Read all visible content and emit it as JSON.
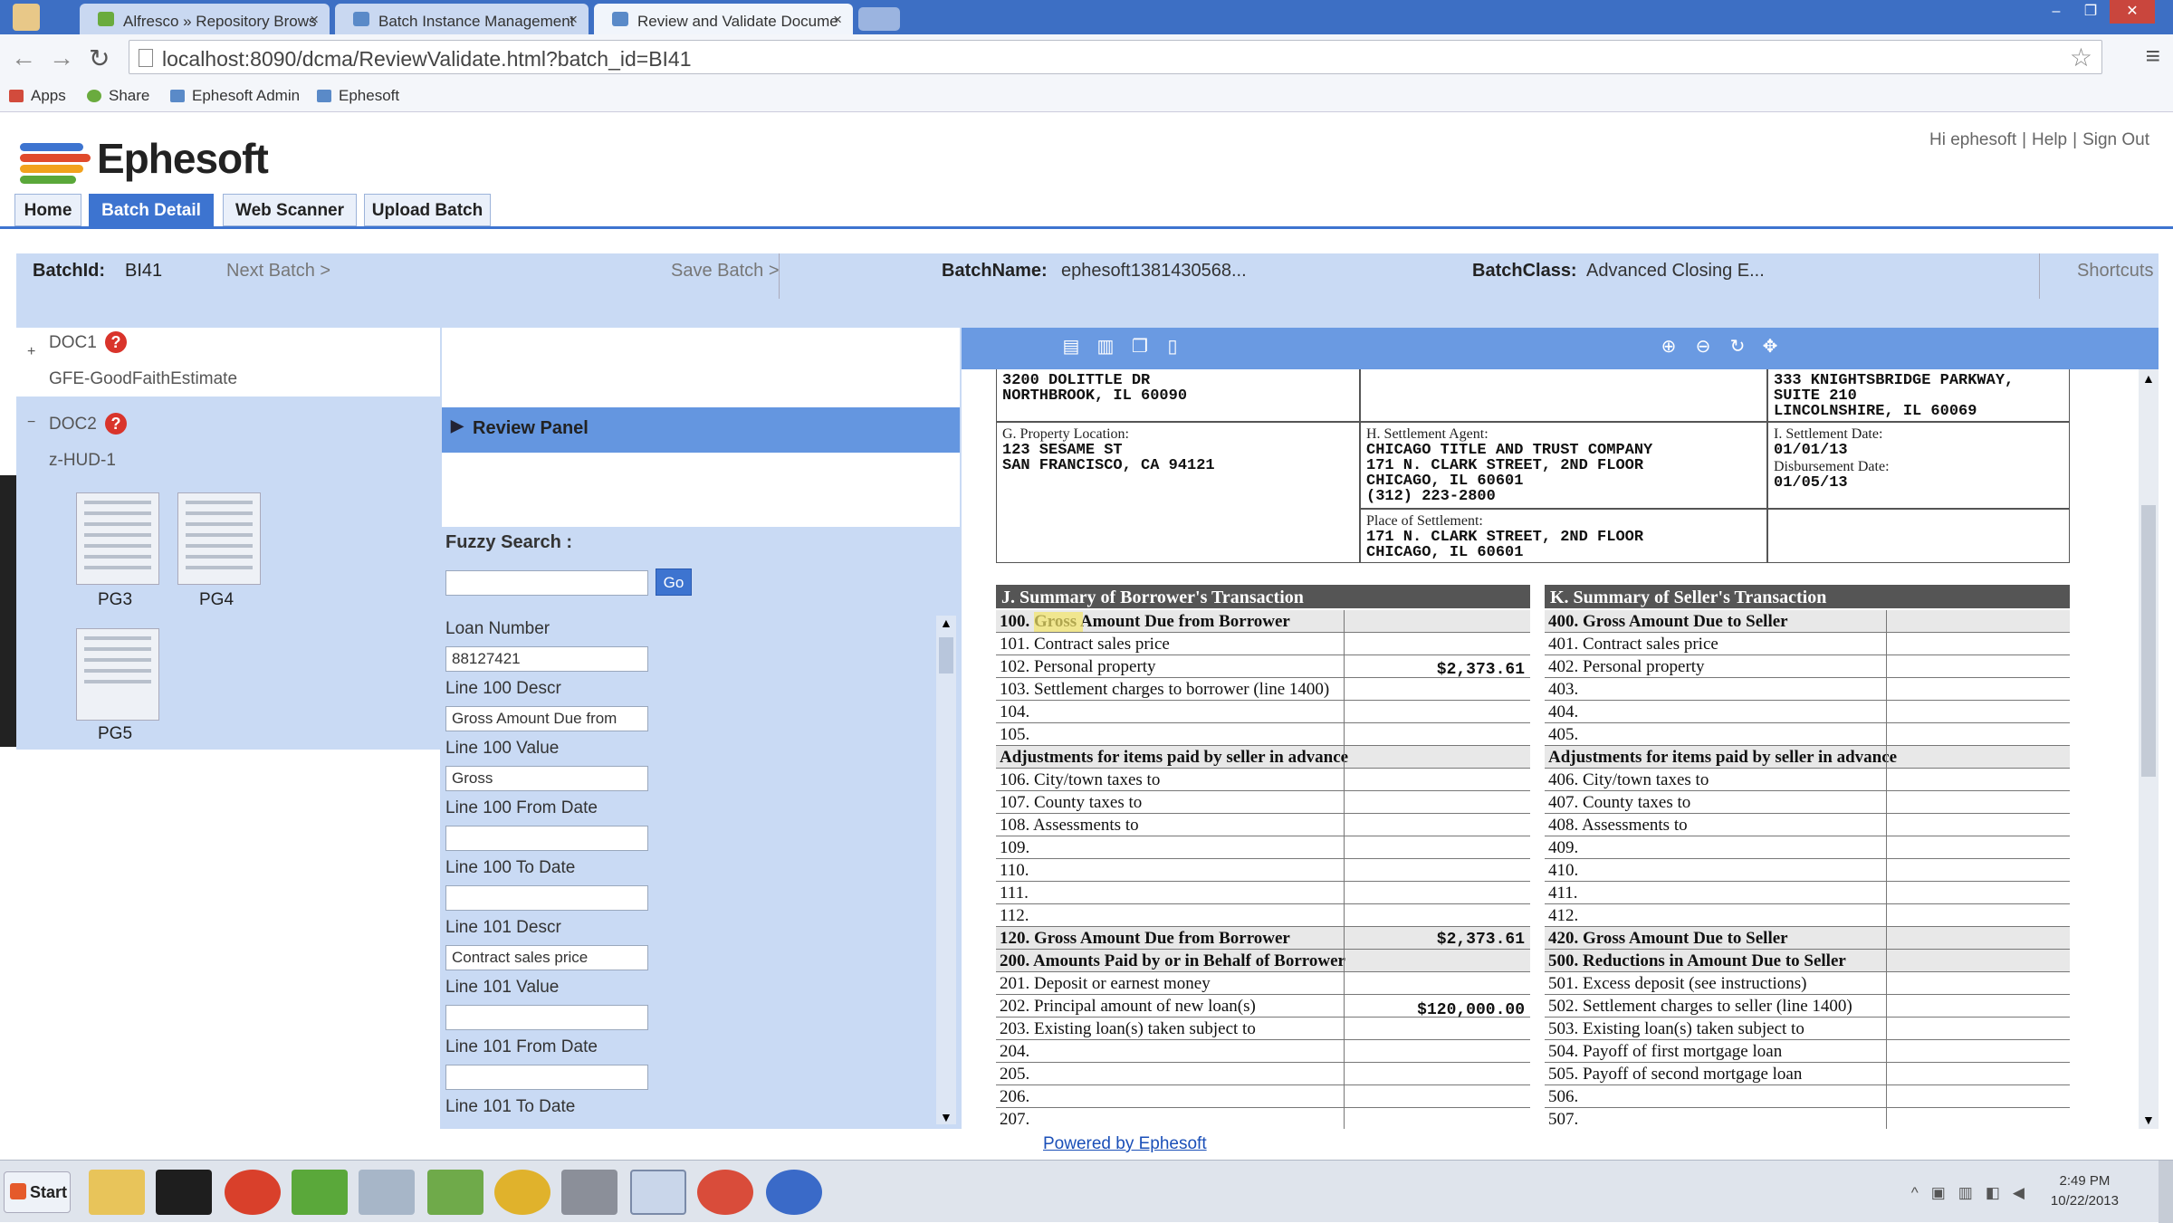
{
  "browser": {
    "tabs": [
      {
        "label": "Alfresco » Repository Brows",
        "icon_color": "#6aab3e"
      },
      {
        "label": "Batch Instance Management",
        "icon_color": "#5a8ac8"
      },
      {
        "label": "Review and Validate Docume",
        "icon_color": "#5a8ac8"
      }
    ],
    "url": "localhost:8090/dcma/ReviewValidate.html?batch_id=BI41",
    "bookmarks": [
      "Apps",
      "Share",
      "Ephesoft Admin",
      "Ephesoft"
    ]
  },
  "app": {
    "logo": "Ephesoft",
    "user_links": [
      "Hi ephesoft",
      "Help",
      "Sign Out"
    ],
    "nav_tabs": [
      "Home",
      "Batch Detail",
      "Web Scanner",
      "Upload Batch"
    ]
  },
  "batch": {
    "id_label": "BatchId:",
    "id_value": "BI41",
    "next_batch": "Next Batch >",
    "save_batch": "Save Batch >",
    "name_label": "BatchName:",
    "name_value": "ephesoft1381430568...",
    "class_label": "BatchClass:",
    "class_value": "Advanced Closing E...",
    "shortcuts": "Shortcuts"
  },
  "documents": [
    {
      "id": "DOC1",
      "type": "GFE-GoodFaithEstimate",
      "expand": "+"
    },
    {
      "id": "DOC2",
      "type": "z-HUD-1",
      "expand": "−",
      "pages": [
        "PG3",
        "PG4",
        "PG5"
      ]
    }
  ],
  "review": {
    "panel_title": "Review Panel",
    "fuzzy_label": "Fuzzy Search :",
    "go_label": "Go",
    "fields": [
      {
        "label": "Loan Number",
        "value": "88127421"
      },
      {
        "label": "Line 100 Descr",
        "value": "Gross Amount Due from"
      },
      {
        "label": "Line 100 Value",
        "value": "Gross"
      },
      {
        "label": "Line 100 From Date",
        "value": ""
      },
      {
        "label": "Line 100 To Date",
        "value": ""
      },
      {
        "label": "Line 101 Descr",
        "value": "Contract sales price"
      },
      {
        "label": "Line 101 Value",
        "value": ""
      },
      {
        "label": "Line 101 From Date",
        "value": ""
      },
      {
        "label": "Line 101 To Date",
        "value": ""
      }
    ]
  },
  "hud": {
    "top_left": "3200 DOLITTLE DR\nNORTHBROOK, IL 60090",
    "top_right": "333 KNIGHTSBRIDGE PARKWAY,\nSUITE 210\nLINCOLNSHIRE, IL 60069",
    "property_label": "G. Property Location:",
    "property": "123 SESAME ST\nSAN FRANCISCO, CA 94121",
    "agent_label": "H. Settlement Agent:",
    "agent": "CHICAGO TITLE AND TRUST COMPANY\n171 N. CLARK STREET, 2ND FLOOR\nCHICAGO, IL 60601\n(312) 223-2800",
    "place_label": "Place of Settlement:",
    "place": "171 N. CLARK STREET, 2ND FLOOR\nCHICAGO, IL 60601",
    "settle_label": "I. Settlement Date:",
    "settle_date": "01/01/13",
    "disb_label": "Disbursement Date:",
    "disb_date": "01/05/13",
    "j_header": "J. Summary of Borrower's Transaction",
    "k_header": "K. Summary of Seller's Transaction",
    "j_lines": [
      "100. Gross Amount Due from Borrower",
      "101. Contract sales price",
      "102. Personal property",
      "103. Settlement charges to borrower (line 1400)",
      "104.",
      "105.",
      "Adjustments for items paid by seller in advance",
      "106. City/town taxes to",
      "107. County taxes to",
      "108. Assessments to",
      "109.",
      "110.",
      "111.",
      "112.",
      "120. Gross Amount Due from Borrower",
      "200. Amounts Paid by or in Behalf of Borrower",
      "201. Deposit or earnest money",
      "202. Principal amount of new loan(s)",
      "203. Existing loan(s) taken subject to",
      "204.",
      "205.",
      "206.",
      "207."
    ],
    "k_lines": [
      "400. Gross Amount Due to Seller",
      "401. Contract sales price",
      "402. Personal property",
      "403.",
      "404.",
      "405.",
      "Adjustments for items paid by seller in advance",
      "406. City/town taxes to",
      "407. County taxes to",
      "408. Assessments to",
      "409.",
      "410.",
      "411.",
      "412.",
      "420. Gross Amount Due to Seller",
      "500. Reductions in Amount Due to Seller",
      "501. Excess deposit (see instructions)",
      "502. Settlement charges to seller (line 1400)",
      "503. Existing loan(s) taken subject to",
      "504. Payoff of first mortgage loan",
      "505. Payoff of second mortgage loan",
      "506.",
      "507."
    ],
    "amount_103": "$2,373.61",
    "amount_120": "$2,373.61",
    "amount_202": "$120,000.00"
  },
  "footer": {
    "link": "Powered by Ephesoft"
  },
  "taskbar": {
    "start": "Start",
    "time": "2:49 PM",
    "date": "10/22/2013"
  }
}
